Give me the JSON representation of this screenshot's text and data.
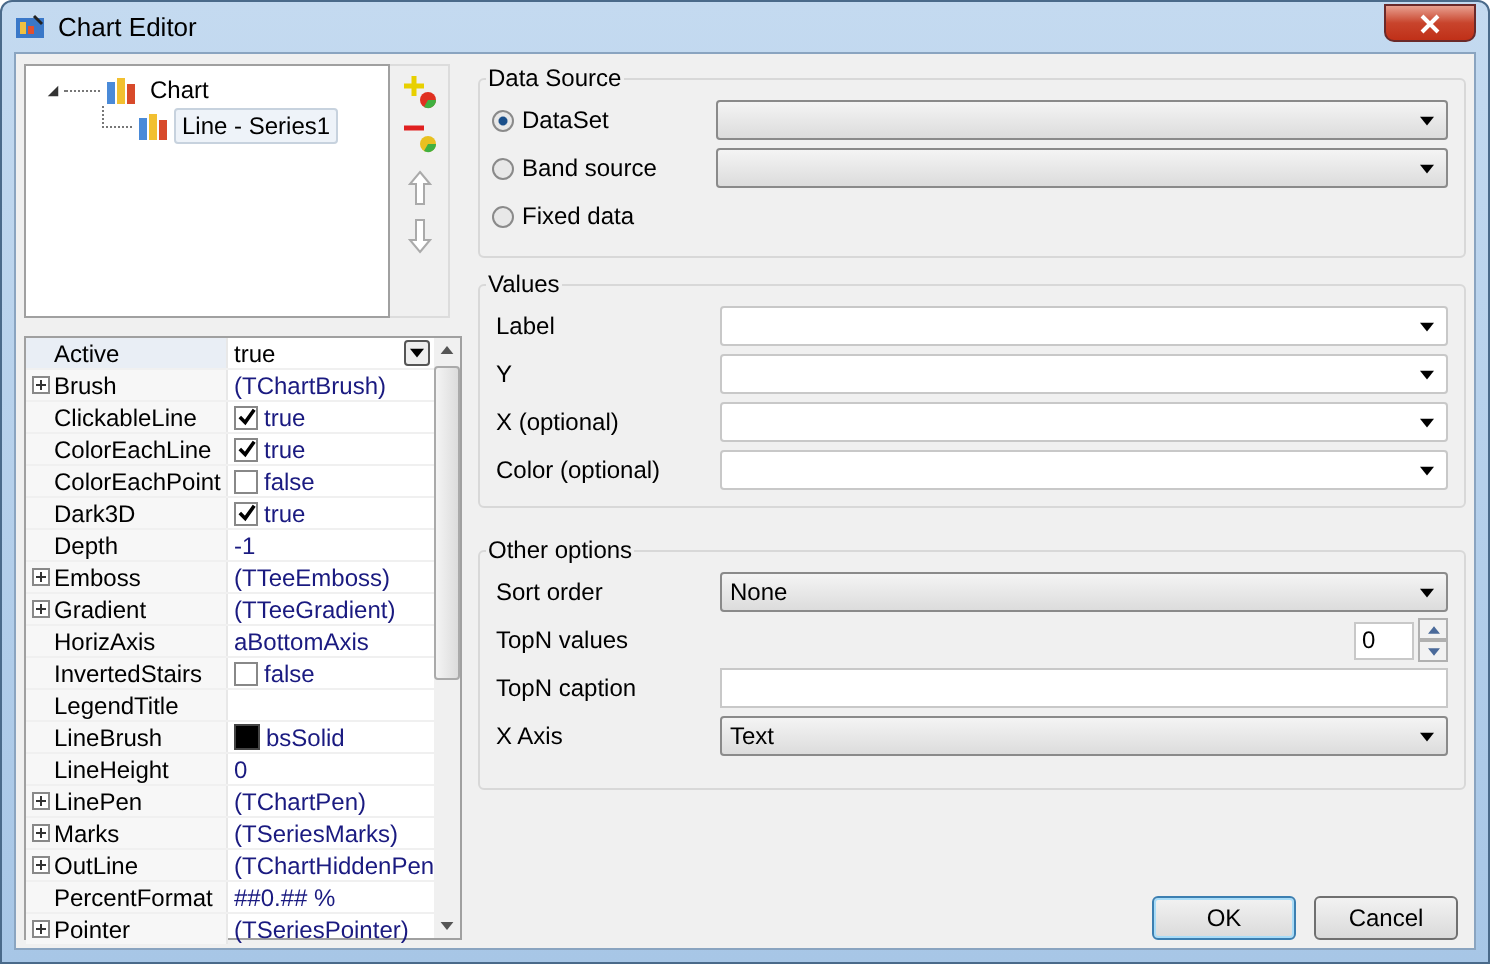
{
  "window": {
    "title": "Chart Editor"
  },
  "tree": [
    {
      "label": "Chart",
      "expanded": true,
      "selected": false,
      "children": [
        {
          "label": "Line - Series1",
          "selected": true
        }
      ]
    }
  ],
  "properties": [
    {
      "name": "Active",
      "value": "true",
      "kind": "dropdown",
      "expandable": false,
      "selected": true
    },
    {
      "name": "Brush",
      "value": "(TChartBrush)",
      "kind": "text",
      "expandable": true,
      "selected": false
    },
    {
      "name": "ClickableLine",
      "value": "true",
      "kind": "check",
      "checked": true,
      "expandable": false,
      "selected": false
    },
    {
      "name": "ColorEachLine",
      "value": "true",
      "kind": "check",
      "checked": true,
      "expandable": false,
      "selected": false
    },
    {
      "name": "ColorEachPoint",
      "value": "false",
      "kind": "check",
      "checked": false,
      "expandable": false,
      "selected": false
    },
    {
      "name": "Dark3D",
      "value": "true",
      "kind": "check",
      "checked": true,
      "expandable": false,
      "selected": false
    },
    {
      "name": "Depth",
      "value": "-1",
      "kind": "text",
      "expandable": false,
      "selected": false
    },
    {
      "name": "Emboss",
      "value": "(TTeeEmboss)",
      "kind": "text",
      "expandable": true,
      "selected": false
    },
    {
      "name": "Gradient",
      "value": "(TTeeGradient)",
      "kind": "text",
      "expandable": true,
      "selected": false
    },
    {
      "name": "HorizAxis",
      "value": "aBottomAxis",
      "kind": "text",
      "expandable": false,
      "selected": false
    },
    {
      "name": "InvertedStairs",
      "value": "false",
      "kind": "check",
      "checked": false,
      "expandable": false,
      "selected": false
    },
    {
      "name": "LegendTitle",
      "kind": "text",
      "expandable": false,
      "selected": false
    },
    {
      "name": "LineBrush",
      "value": "bsSolid",
      "kind": "color",
      "color": "#000000",
      "expandable": false,
      "selected": false
    },
    {
      "name": "LineHeight",
      "value": "0",
      "kind": "text",
      "expandable": false,
      "selected": false
    },
    {
      "name": "LinePen",
      "value": "(TChartPen)",
      "kind": "text",
      "expandable": true,
      "selected": false
    },
    {
      "name": "Marks",
      "value": "(TSeriesMarks)",
      "kind": "text",
      "expandable": true,
      "selected": false
    },
    {
      "name": "OutLine",
      "value": "(TChartHiddenPen",
      "kind": "text",
      "expandable": true,
      "selected": false
    },
    {
      "name": "PercentFormat",
      "value": "##0.## %",
      "kind": "text",
      "expandable": false,
      "selected": false
    },
    {
      "name": "Pointer",
      "value": "(TSeriesPointer)",
      "kind": "text",
      "expandable": true,
      "selected": false
    }
  ],
  "data_source": {
    "title": "Data Source",
    "options": [
      {
        "label": "DataSet",
        "selected": true,
        "has_combo": true
      },
      {
        "label": "Band source",
        "selected": false,
        "has_combo": true
      },
      {
        "label": "Fixed data",
        "selected": false,
        "has_combo": false
      }
    ]
  },
  "values": {
    "title": "Values",
    "fields": [
      {
        "label": "Label"
      },
      {
        "label": "Y"
      },
      {
        "label": "X (optional)"
      },
      {
        "label": "Color (optional)"
      }
    ]
  },
  "other_options": {
    "title": "Other options",
    "fields": [
      {
        "label": "Sort order",
        "kind": "combo",
        "value": "None"
      },
      {
        "label": "TopN values",
        "kind": "spin",
        "value": "0"
      },
      {
        "label": "TopN caption",
        "kind": "input"
      },
      {
        "label": "X Axis",
        "kind": "combo",
        "value": "Text"
      }
    ]
  },
  "buttons": [
    {
      "label": "OK",
      "default": true
    },
    {
      "label": "Cancel",
      "default": false
    }
  ]
}
